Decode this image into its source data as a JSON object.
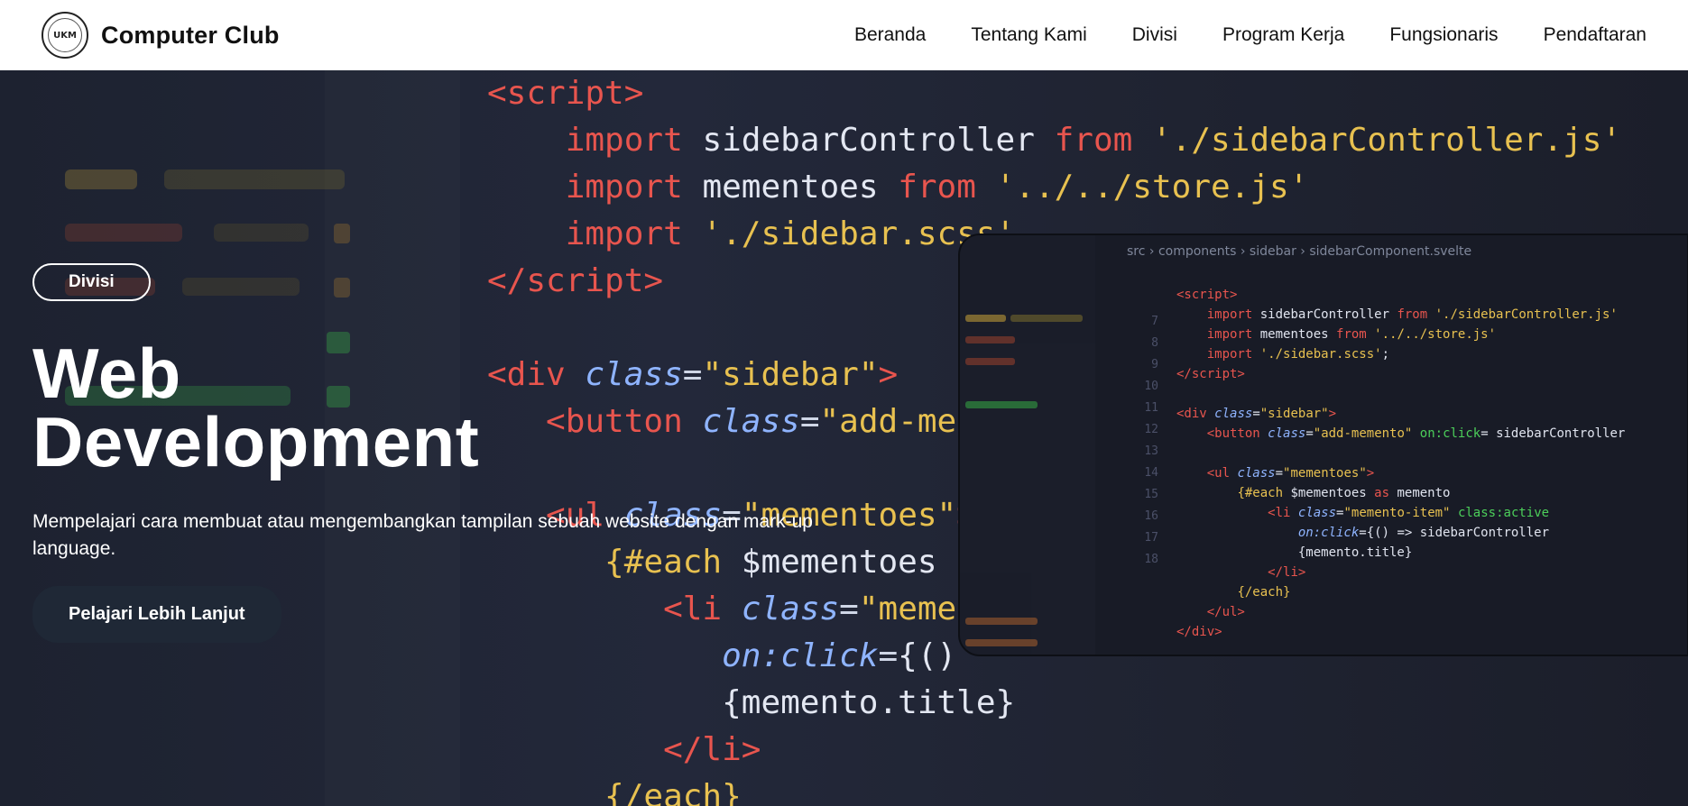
{
  "header": {
    "brand_name": "Computer Club",
    "logo_text": "UKM",
    "nav": [
      "Beranda",
      "Tentang Kami",
      "Divisi",
      "Program Kerja",
      "Fungsionaris",
      "Pendaftaran"
    ]
  },
  "hero": {
    "pill_label": "Divisi",
    "title_line1": "Web",
    "title_line2": "Development",
    "description": "Mempelajari cara membuat atau mengembangkan tampilan sebuah website dengan mark-up language.",
    "cta_label": "Pelajari Lebih Lanjut"
  },
  "colors": {
    "header_bg": "#ffffff",
    "hero_bg": "#1d2230",
    "cta_bg": "#1f2836",
    "code_keyword": "#e8554e",
    "code_string": "#e8c150"
  }
}
